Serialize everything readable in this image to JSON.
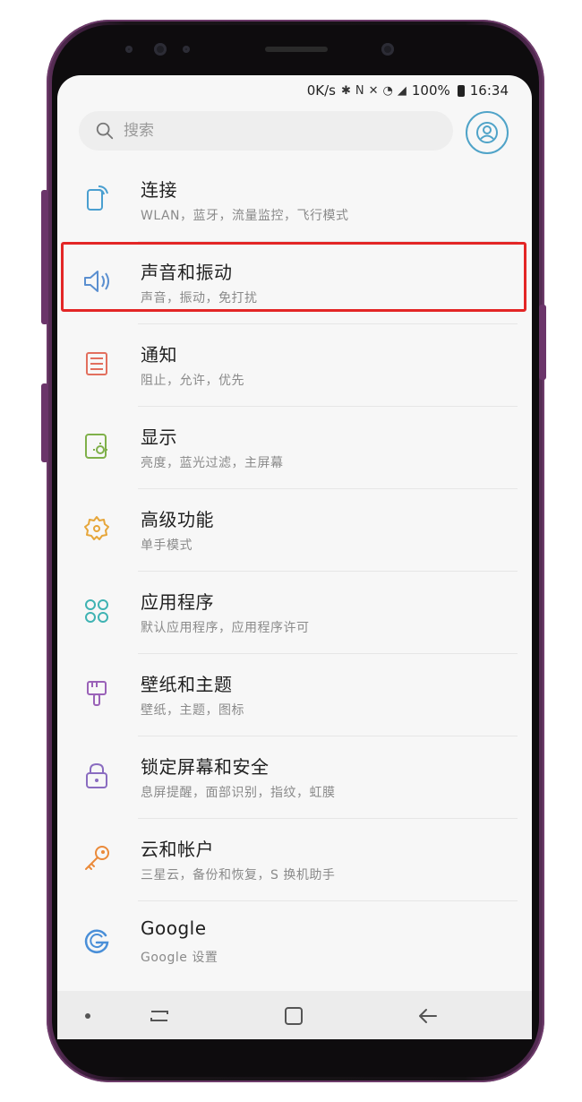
{
  "status_bar": {
    "speed": "0K/s",
    "icons": [
      "bluetooth-icon",
      "nfc-icon",
      "mute-icon",
      "wifi-icon",
      "signal-icon"
    ],
    "battery": "100%",
    "time": "16:34"
  },
  "search": {
    "placeholder": "搜索"
  },
  "settings": [
    {
      "title": "连接",
      "subtitle": "WLAN，蓝牙，流量监控，飞行模式",
      "icon": "connection-icon",
      "color": "#4a9fd0"
    },
    {
      "title": "声音和振动",
      "subtitle": "声音，振动，免打扰",
      "icon": "speaker-icon",
      "color": "#5a8fd0"
    },
    {
      "title": "通知",
      "subtitle": "阻止，允许，优先",
      "icon": "notification-icon",
      "color": "#e26f5e"
    },
    {
      "title": "显示",
      "subtitle": "亮度，蓝光过滤，主屏幕",
      "icon": "display-icon",
      "color": "#7fb04a"
    },
    {
      "title": "高级功能",
      "subtitle": "单手模式",
      "icon": "advanced-gear-icon",
      "color": "#e6a63a"
    },
    {
      "title": "应用程序",
      "subtitle": "默认应用程序，应用程序许可",
      "icon": "apps-icon",
      "color": "#3fb3b3"
    },
    {
      "title": "壁纸和主题",
      "subtitle": "壁纸，主题，图标",
      "icon": "brush-icon",
      "color": "#9a62b8"
    },
    {
      "title": "锁定屏幕和安全",
      "subtitle": "息屏提醒，面部识别，指纹，虹膜",
      "icon": "lock-icon",
      "color": "#8a6cc0"
    },
    {
      "title": "云和帐户",
      "subtitle": "三星云，备份和恢复，S 换机助手",
      "icon": "key-icon",
      "color": "#ea8a3a"
    },
    {
      "title": "Google",
      "subtitle": "Google 设置",
      "icon": "google-icon",
      "color": "#4a8fd8"
    }
  ],
  "highlight_color": "#e32626"
}
